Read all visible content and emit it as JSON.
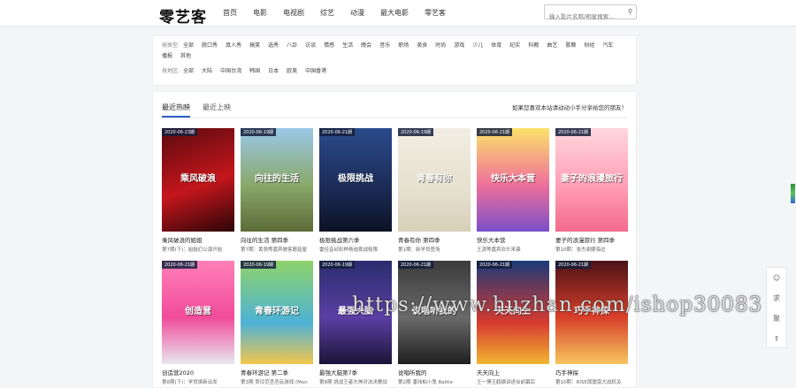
{
  "header": {
    "logo": "零艺客",
    "nav": [
      "首页",
      "电影",
      "电视剧",
      "综艺",
      "动漫",
      "最大电影",
      "零艺客"
    ],
    "search_placeholder": "输入影片名称/明星搜索...",
    "search_icon": "search-icon"
  },
  "filters": {
    "category_label": "按类型:",
    "categories": [
      "全部",
      "脱口秀",
      "真人秀",
      "搞笑",
      "选秀",
      "八卦",
      "访谈",
      "情感",
      "生活",
      "晚会",
      "音乐",
      "职场",
      "美食",
      "时尚",
      "游戏",
      "少儿",
      "体育",
      "纪实",
      "科教",
      "曲艺",
      "歌舞",
      "财经",
      "汽车",
      "播报",
      "其他"
    ],
    "region_label": "按地区:",
    "regions": [
      "全部",
      "大陆",
      "中国台湾",
      "韩国",
      "日本",
      "欧美",
      "中国香港"
    ]
  },
  "tabs": [
    "最近热映",
    "最近上映"
  ],
  "hint": "如果您喜欢本站请动动小手分享给您的朋友！",
  "cards": [
    {
      "badge": "2020-06-23期",
      "title": "乘风破浪的姐姐",
      "sub": "第7期(下)：姐姐们公演开始",
      "bg": "linear-gradient(160deg,#5a0a0f,#c4161c 55%,#2a0508)",
      "ptext": "乘风破浪"
    },
    {
      "badge": "2020-06-19期",
      "title": "向往的生活 第四季",
      "sub": "第7期：黄渤等嘉宾做客蘑菇屋",
      "bg": "linear-gradient(180deg,#9ac8e8,#8aa86a 55%,#5c6b38)",
      "ptext": "向往的生活"
    },
    {
      "badge": "2020-06-21期",
      "title": "极限挑战第六季",
      "sub": "雷佳音邱彩桦杨迪挑战极限",
      "bg": "linear-gradient(180deg,#2a4b8c,#1b2a55 60%,#0c1224)",
      "ptext": "极限挑战"
    },
    {
      "badge": "2020-06-19期",
      "title": "青春有你 第四季",
      "sub": "第1期：新学员登场",
      "bg": "linear-gradient(180deg,#f1ede2,#e6e0cf 60%,#d8cfb8)",
      "ptext": "青春有你"
    },
    {
      "badge": "2020-06-21期",
      "title": "快乐大本营",
      "sub": "王源等嘉宾欢乐来袭",
      "bg": "linear-gradient(180deg,#fbe26a,#ef6f9b 55%,#7b4fc9)",
      "ptext": "快乐大本营"
    },
    {
      "badge": "2020-06-21期",
      "title": "妻子的浪漫旅行 第四季",
      "sub": "第10期：张杰谢娜海边",
      "bg": "linear-gradient(180deg,#ffd7df,#ff9ab0 60%,#f46a8c)",
      "ptext": "妻子的浪漫旅行"
    },
    {
      "badge": "2020-06-21期",
      "title": "创造营2020",
      "sub": "第8期(下)：学员焕新出发",
      "bg": "linear-gradient(180deg,#ff7fb8,#f04c9a 55%,#e8e8f0)",
      "ptext": "创造营"
    },
    {
      "badge": "2020-06-19期",
      "title": "青春环游记 第二季",
      "sub": "第3期 贾玲范丞丞玩游戏 (Mon",
      "bg": "linear-gradient(180deg,#8fd36a,#4db2d6 60%,#f4c64d)",
      "ptext": "青春环游记"
    },
    {
      "badge": "2020-06-19期",
      "title": "最强大脑第7季",
      "sub": "第8期 挑战王者大神对决决赛战",
      "bg": "linear-gradient(180deg,#2a2d6e,#5b3fa3 55%,#1a1438)",
      "ptext": "最强大脑"
    },
    {
      "badge": "2020-06-21期",
      "title": "说唱听我的",
      "sub": "第2期 潘玮柏小鬼 Battle",
      "bg": "linear-gradient(180deg,#3b3b3b,#6a6a6a 55%,#1f1f1f)",
      "ptext": "说唱听我的"
    },
    {
      "badge": "2020-06-21期",
      "title": "天天向上",
      "sub": "王一博王鹤棣讲述台前幕后",
      "bg": "linear-gradient(180deg,#1a3a7a,#d73a2f 60%,#f2b632)",
      "ptext": "天天向上"
    },
    {
      "badge": "2020-06-21期",
      "title": "巧手神探",
      "sub": "第10期：RISE周震南大战机关",
      "bg": "linear-gradient(180deg,#4a1218,#d8402a 55%,#f7c65e)",
      "ptext": "巧手神探"
    }
  ],
  "watermark": "https://www.huzhan.com/ishop30083",
  "side_tools": [
    "user-icon",
    "求",
    "聚",
    "top-icon"
  ]
}
